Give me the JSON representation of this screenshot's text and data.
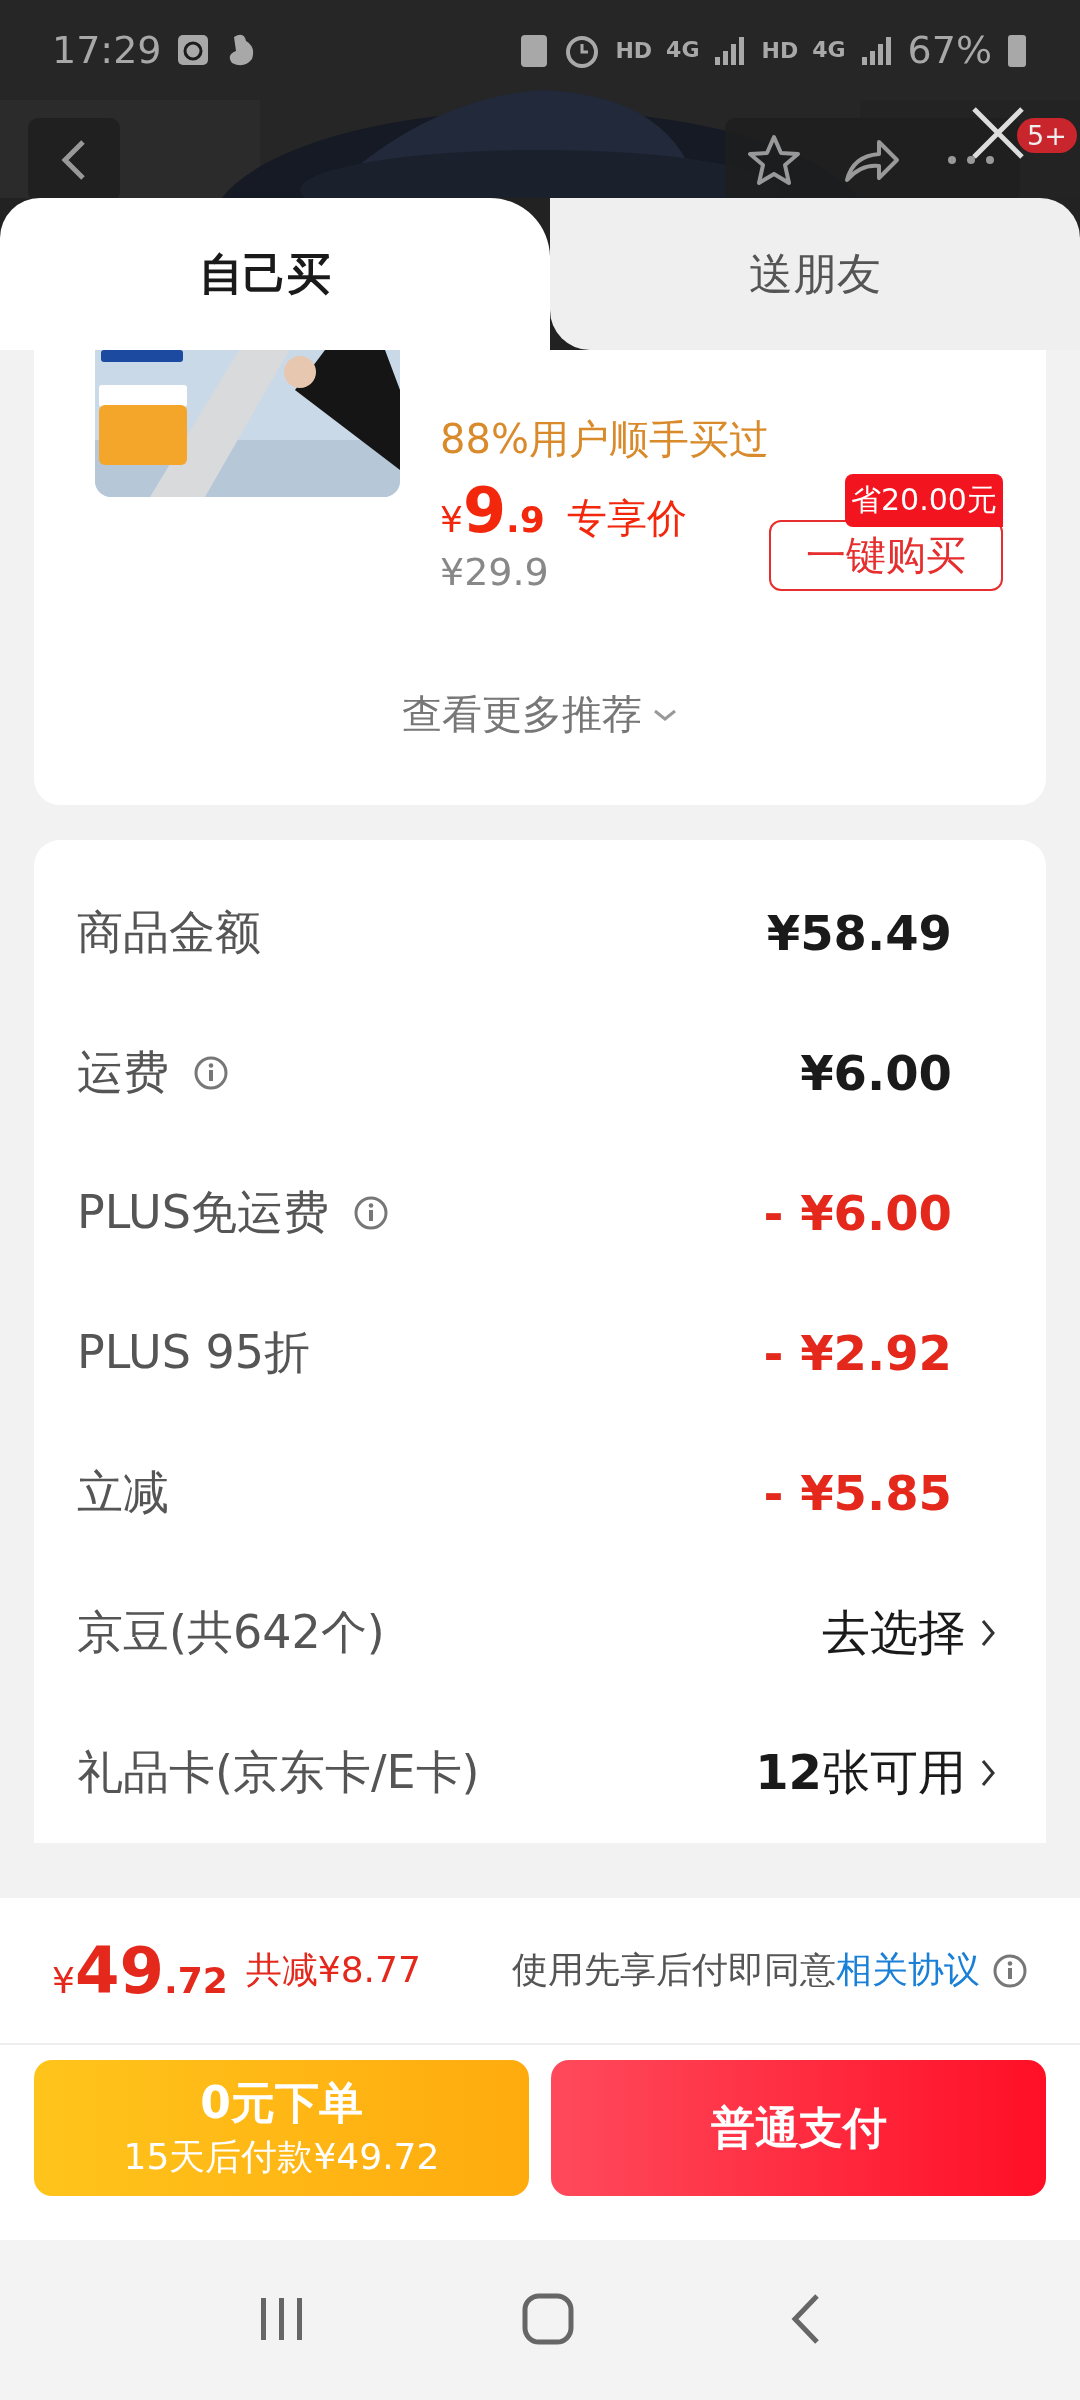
{
  "status_bar": {
    "time": "17:29",
    "networks": [
      {
        "hd": "HD",
        "gen": "4G"
      },
      {
        "hd": "HD",
        "gen": "4G"
      }
    ],
    "battery": "67%"
  },
  "header": {
    "badge": "5+"
  },
  "tabs": [
    {
      "label": "自己买",
      "selected": true
    },
    {
      "label": "送朋友",
      "selected": false
    }
  ],
  "product": {
    "buy_rate": "88%用户顺手买过",
    "price_symbol": "¥",
    "price_int": "9",
    "price_dec": ".9",
    "price_tag": "专享价",
    "original_price": "¥29.9",
    "savings_badge": "省20.00元",
    "buy_button": "一键购买"
  },
  "more_recommendations": "查看更多推荐",
  "summary": {
    "rows": [
      {
        "label": "商品金额",
        "info": false,
        "kind": "amount",
        "value": "¥58.49"
      },
      {
        "label": "运费",
        "info": true,
        "kind": "amount",
        "value": "¥6.00"
      },
      {
        "label": "PLUS免运费",
        "info": true,
        "kind": "discount",
        "value": "- ¥6.00"
      },
      {
        "label": "PLUS 95折",
        "info": false,
        "kind": "discount",
        "value": "- ¥2.92"
      },
      {
        "label": "立减",
        "info": false,
        "kind": "discount",
        "value": "- ¥5.85"
      },
      {
        "label": "京豆(共642个)",
        "info": false,
        "kind": "link",
        "value": "去选择"
      },
      {
        "label": "礼品卡(京东卡/E卡)",
        "info": false,
        "kind": "link",
        "value": "**12**张可用"
      }
    ]
  },
  "footer": {
    "total_symbol": "¥",
    "total_int": "49",
    "total_dec": ".72",
    "saved": "共减¥8.77",
    "agreement": "使用先享后付即同意",
    "agreement_link": "相关协议"
  },
  "buttons": [
    {
      "kind": "later",
      "title": "0元下单",
      "subtitle": "15天后付款¥49.72"
    },
    {
      "kind": "pay",
      "title": "普通支付"
    }
  ]
}
